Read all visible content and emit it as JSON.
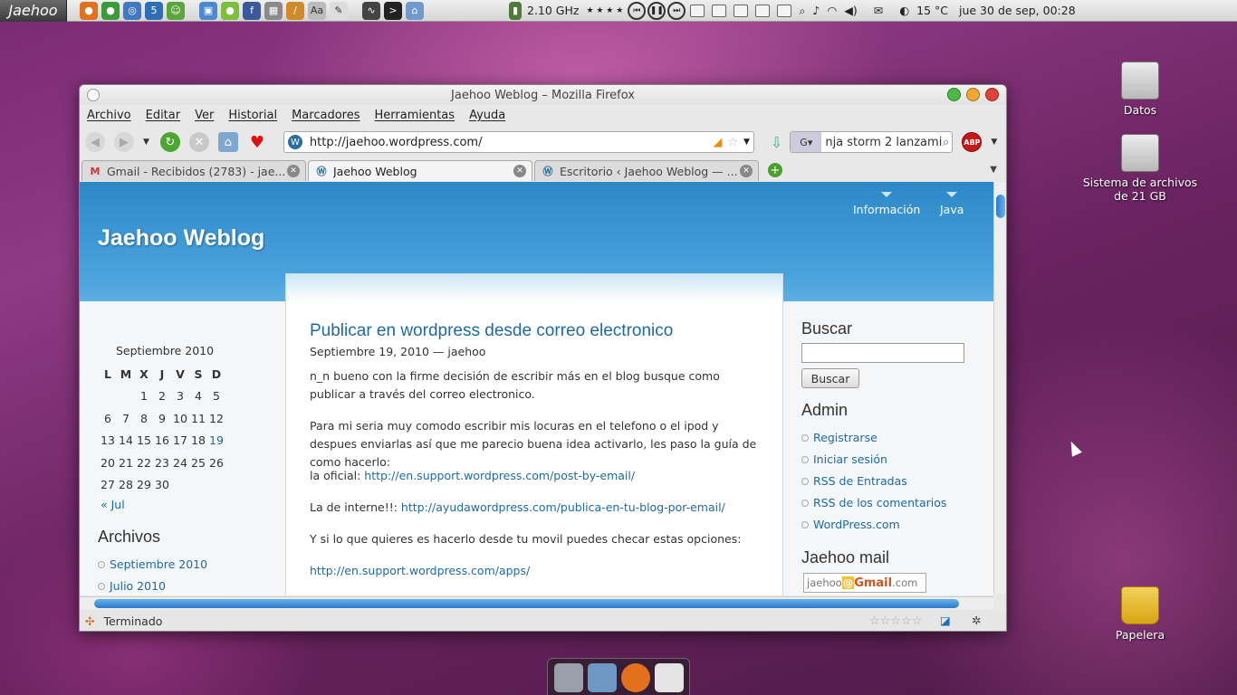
{
  "top_panel": {
    "menu_label": "Jaehoo",
    "cpu": "2.10 GHz",
    "cpu_dots": "★ ★ ★ ★",
    "weather": "15 °C",
    "datetime": "jue 30 de sep, 00:28"
  },
  "window": {
    "title": "Jaehoo Weblog – Mozilla Firefox",
    "menu": [
      "Archivo",
      "Editar",
      "Ver",
      "Historial",
      "Marcadores",
      "Herramientas",
      "Ayuda"
    ],
    "url": "http://jaehoo.wordpress.com/",
    "search_value": "nja storm 2 lanzami",
    "tabs": [
      {
        "label": "Gmail - Recibidos (2783) - jae...",
        "favicon": "gmail-icon",
        "active": false
      },
      {
        "label": "Jaehoo Weblog",
        "favicon": "wordpress-icon",
        "active": true
      },
      {
        "label": "Escritorio ‹ Jaehoo Weblog — ...",
        "favicon": "wordpress-icon",
        "active": false
      }
    ],
    "status": "Terminado"
  },
  "site": {
    "title": "Jaehoo Weblog",
    "nav": [
      "Información",
      "Java"
    ],
    "post": {
      "title": "Publicar en wordpress desde correo electronico",
      "meta": "Septiembre 19, 2010 — jaehoo",
      "p1": "n_n bueno con la firme decisión de escribir más en el blog busque como publicar a través del correo electronico.",
      "p2": "Para mi seria muy comodo escribir mis locuras en el telefono o el ipod y despues enviarlas así que me parecio buena idea activarlo, les paso la guía de como hacerlo:",
      "p3_prefix": "la oficial: ",
      "p3_link": "http://en.support.wordpress.com/post-by-email/",
      "p4_prefix": "La de interne!!: ",
      "p4_link": "http://ayudawordpress.com/publica-en-tu-blog-por-email/",
      "p5": "Y si lo que quieres es hacerlo desde tu movil puedes checar estas opciones:",
      "p6_link": "http://en.support.wordpress.com/apps/"
    },
    "calendar": {
      "caption": "Septiembre 2010",
      "days": [
        "L",
        "M",
        "X",
        "J",
        "V",
        "S",
        "D"
      ],
      "weeks": [
        [
          "",
          "",
          "1",
          "2",
          "3",
          "4",
          "5"
        ],
        [
          "6",
          "7",
          "8",
          "9",
          "10",
          "11",
          "12"
        ],
        [
          "13",
          "14",
          "15",
          "16",
          "17",
          "18",
          "19"
        ],
        [
          "20",
          "21",
          "22",
          "23",
          "24",
          "25",
          "26"
        ],
        [
          "27",
          "28",
          "29",
          "30",
          "",
          "",
          ""
        ]
      ],
      "linked_day": "19",
      "prev": "« Jul"
    },
    "archives": {
      "heading": "Archivos",
      "items": [
        "Septiembre 2010",
        "Julio 2010"
      ]
    },
    "search": {
      "heading": "Buscar",
      "button": "Buscar"
    },
    "admin": {
      "heading": "Admin",
      "items": [
        "Registrarse",
        "Iniciar sesión",
        "RSS de Entradas",
        "RSS de los comentarios",
        "WordPress.com"
      ]
    },
    "mail": {
      "heading": "Jaehoo mail",
      "user": "jaehoo",
      "at": "@",
      "brand": "Gmail",
      "domain": ".com"
    }
  },
  "desktop": {
    "icons": [
      "Datos",
      "Sistema de archivos de 21 GB",
      "Papelera"
    ]
  },
  "colors": {
    "accent": "#2d88c8",
    "link": "#1e6aa3"
  }
}
